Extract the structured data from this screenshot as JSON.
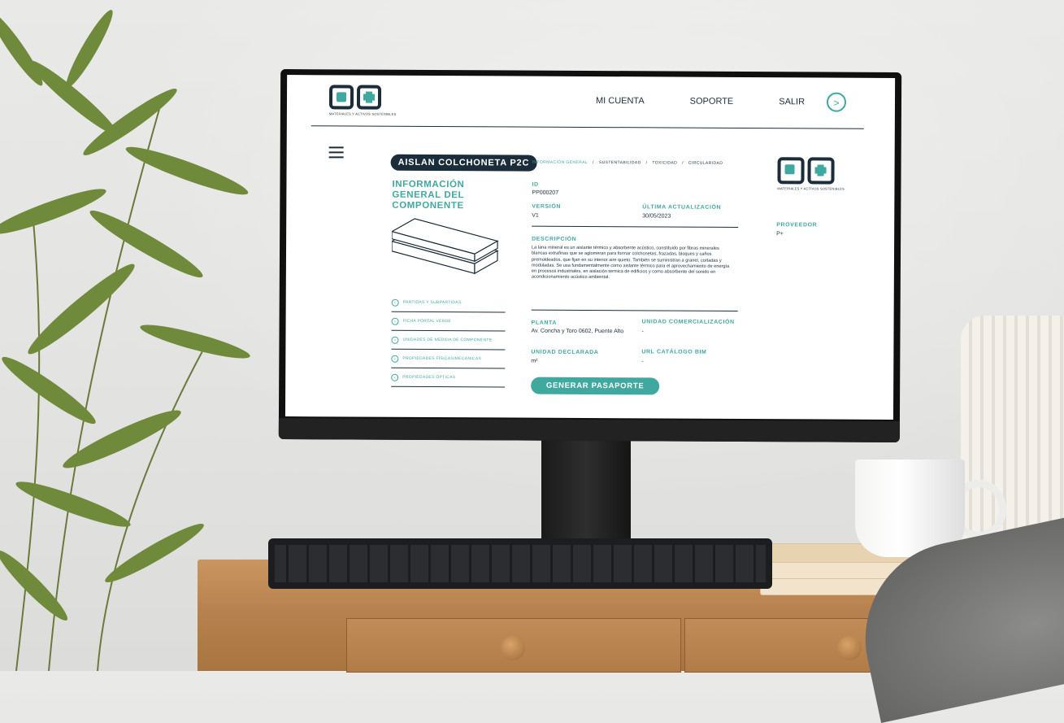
{
  "nav": {
    "logo_tagline": "MATERIALES Y ACTIVOS SOSTENIBLES",
    "links": [
      "MI CUENTA",
      "SOPORTE",
      "SALIR"
    ],
    "go_icon": ">"
  },
  "component": {
    "name": "AISLAN COLCHONETA P2C",
    "section_title": "INFORMACIÓN GENERAL DEL COMPONENTE"
  },
  "side_menu": [
    {
      "label": "PARTIDAS Y SUBPARTIDAS",
      "icon": "chevron-down-icon"
    },
    {
      "label": "FICHA PORTAL VERDE",
      "icon": "chevron-down-icon"
    },
    {
      "label": "UNIDADES DE MEDIDA DE COMPONENTE",
      "icon": "chevron-down-icon"
    },
    {
      "label": "PROPIEDADES FÍSICAS/MECÁNICAS",
      "icon": "chevron-down-icon"
    },
    {
      "label": "PROPIEDADES ÓPTICAS",
      "icon": "chevron-down-icon"
    }
  ],
  "breadcrumb": [
    "INFORMACIÓN GENERAL",
    "SUSTENTABILIDAD",
    "TOXICIDAD",
    "CIRCULARIDAD"
  ],
  "fields": {
    "id_label": "ID",
    "id_value": "PP000207",
    "version_label": "VERSIÓN",
    "version_value": "V1",
    "updated_label": "ÚLTIMA ACTUALIZACIÓN",
    "updated_value": "30/05/2023",
    "description_label": "DESCRIPCIÓN",
    "description_value": "La lana mineral es un aislante térmico y absorbente acústico, constituido por fibras minerales blancas extrafinas que se aglomeran para formar colchonetas, frazadas, bloques y caños premoldeados, que fijan en su interior aire quieto. También se suministran a granel, cortadas y moduladas. Se usa fundamentalmente como aislante térmico para el aprovechamiento de energía en procesos industriales, en aislación termica de edificios y como absorbente del sonido en acondicionamiento acústico ambiental.",
    "plant_label": "PLANTA",
    "plant_value": "Av. Concha y Toro 0602, Puente Alto",
    "commercial_unit_label": "UNIDAD COMERCIALIZACIÓN",
    "commercial_unit_value": "-",
    "declared_unit_label": "UNIDAD DECLARADA",
    "declared_unit_value": "m²",
    "bim_label": "URL CATÁLOGO BIM",
    "bim_value": "-",
    "provider_label": "PROVEEDOR",
    "provider_value": "P+"
  },
  "cta_label": "GENERAR PASAPORTE",
  "colors": {
    "teal": "#3fa9a0",
    "navy": "#1b2d3a"
  }
}
